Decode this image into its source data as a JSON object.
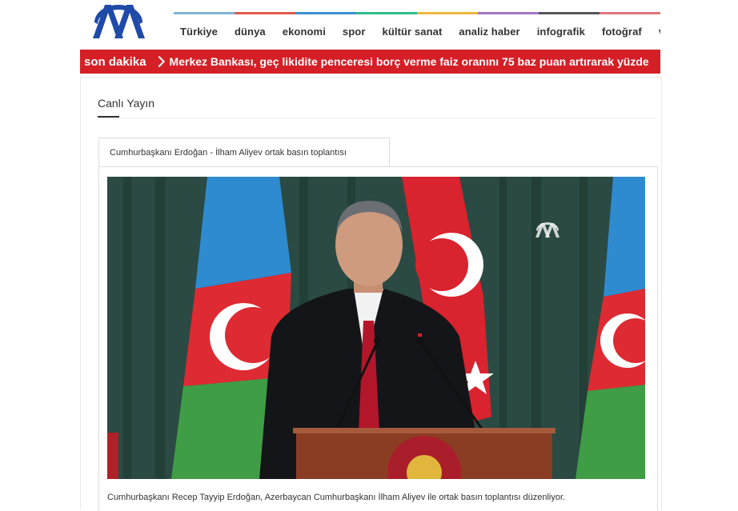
{
  "header": {
    "logo_text": "AA",
    "nav": [
      "Türkiye",
      "dünya",
      "ekonomi",
      "spor",
      "kültür sanat",
      "analiz haber",
      "infografik",
      "fotoğraf",
      "v"
    ],
    "nav_colors": [
      "#7fb4d8",
      "#e2574c",
      "#3d8fcf",
      "#2fbc8a",
      "#f1b73b",
      "#a277c4",
      "#555555",
      "#e5737c"
    ]
  },
  "breaking": {
    "label": "son dakika",
    "text": "Merkez Bankası, geç likidite penceresi borç verme faiz oranını 75 baz puan artırarak yüzde",
    "color": "#d41f26"
  },
  "live": {
    "title": "Canlı Yayın",
    "tab_label": "Cumhurbaşkanı Erdoğan - İlham Aliyev ortak basın toplantısı",
    "caption": "Cumhurbaşkanı Recep Tayyip Erdoğan, Azerbaycan Cumhurbaşkanı İlham Aliyev ile ortak basın toplantısı düzenliyor.",
    "watermark": "AA"
  }
}
